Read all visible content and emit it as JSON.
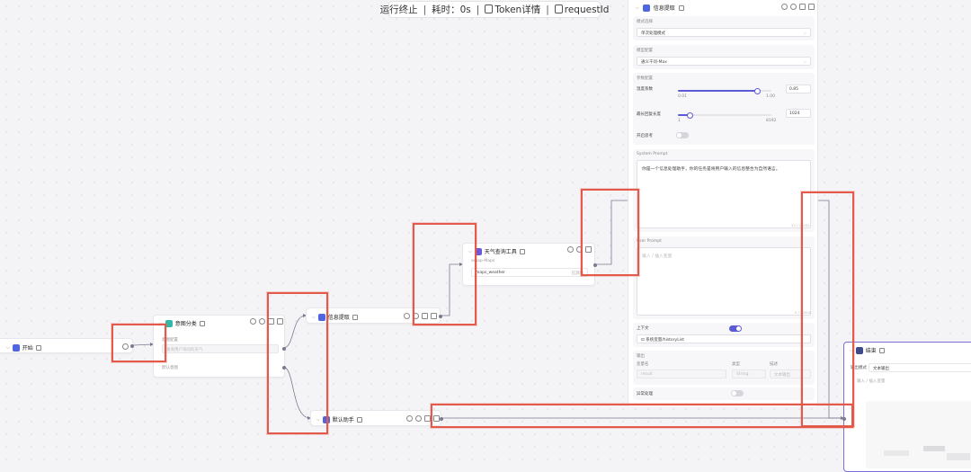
{
  "status": {
    "run_state": "运行终止",
    "elapsed_label": "耗时：0s",
    "token_label": "Token详情",
    "request_label": "requestId"
  },
  "nodes": {
    "start": {
      "title": "开始"
    },
    "intent": {
      "title": "意图分类",
      "intent_config_label": "意图配置",
      "intent_placeholder": "查询用户询问的天气",
      "default_intent_label": "默认意图"
    },
    "info_extract": {
      "title": "信息提取"
    },
    "weather_tool": {
      "title": "天气查询工具",
      "subtitle": "amap-Maps",
      "tool_name": "maps_weather",
      "tool_tag": "已添加"
    },
    "default_assistant": {
      "title": "默认助手"
    },
    "end": {
      "title": "结束",
      "output_mode_label": "输出模式",
      "output_mode_value": "文本输出",
      "reply_placeholder": "输入 / 插入变量"
    }
  },
  "panel": {
    "title": "信息提取",
    "mode_label": "模式选择",
    "mode_value": "单次处理模式",
    "model_label": "模型配置",
    "model_value": "通义千问-Max",
    "params_label": "参数配置",
    "temperature_label": "温度系数",
    "temperature_value": "0.85",
    "temperature_min": "0.01",
    "temperature_max": "1.00",
    "temperature_fraction": 0.85,
    "max_tokens_label": "最长回复长度",
    "max_tokens_value": "1024",
    "max_tokens_min": "1",
    "max_tokens_max": "8192",
    "max_tokens_fraction": 0.125,
    "deep_think_label": "开启思考",
    "system_prompt_label": "System Prompt",
    "system_prompt_value": "你是一个信息处理助手，你的任务是将用户输入的信息整合为自然语言。",
    "system_prompt_count": "32 / 20000",
    "user_prompt_label": "User Prompt",
    "user_prompt_placeholder": "输入 / 插入变量",
    "user_prompt_count": "0 / 20000",
    "context_label": "上下文",
    "context_value": "系统变量/historyList",
    "output_label": "输出",
    "output_col_name": "变量名",
    "output_col_type": "类型",
    "output_col_desc": "描述",
    "output_var_name": "result",
    "output_var_type": "String",
    "output_var_desc": "文本输出",
    "error_label": "异常处理"
  },
  "colors": {
    "accent": "#5b5bd6",
    "annotation": "#e35a4a",
    "edge": "#7a7a90"
  }
}
